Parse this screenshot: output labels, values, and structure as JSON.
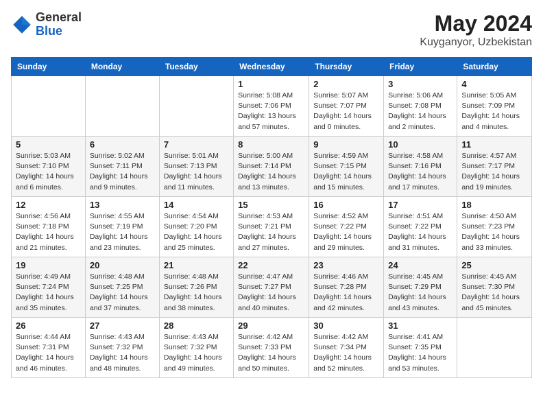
{
  "header": {
    "logo_general": "General",
    "logo_blue": "Blue",
    "month_title": "May 2024",
    "location": "Kuyganyor, Uzbekistan"
  },
  "weekdays": [
    "Sunday",
    "Monday",
    "Tuesday",
    "Wednesday",
    "Thursday",
    "Friday",
    "Saturday"
  ],
  "weeks": [
    [
      {
        "day": "",
        "info": ""
      },
      {
        "day": "",
        "info": ""
      },
      {
        "day": "",
        "info": ""
      },
      {
        "day": "1",
        "info": "Sunrise: 5:08 AM\nSunset: 7:06 PM\nDaylight: 13 hours and 57 minutes."
      },
      {
        "day": "2",
        "info": "Sunrise: 5:07 AM\nSunset: 7:07 PM\nDaylight: 14 hours and 0 minutes."
      },
      {
        "day": "3",
        "info": "Sunrise: 5:06 AM\nSunset: 7:08 PM\nDaylight: 14 hours and 2 minutes."
      },
      {
        "day": "4",
        "info": "Sunrise: 5:05 AM\nSunset: 7:09 PM\nDaylight: 14 hours and 4 minutes."
      }
    ],
    [
      {
        "day": "5",
        "info": "Sunrise: 5:03 AM\nSunset: 7:10 PM\nDaylight: 14 hours and 6 minutes."
      },
      {
        "day": "6",
        "info": "Sunrise: 5:02 AM\nSunset: 7:11 PM\nDaylight: 14 hours and 9 minutes."
      },
      {
        "day": "7",
        "info": "Sunrise: 5:01 AM\nSunset: 7:13 PM\nDaylight: 14 hours and 11 minutes."
      },
      {
        "day": "8",
        "info": "Sunrise: 5:00 AM\nSunset: 7:14 PM\nDaylight: 14 hours and 13 minutes."
      },
      {
        "day": "9",
        "info": "Sunrise: 4:59 AM\nSunset: 7:15 PM\nDaylight: 14 hours and 15 minutes."
      },
      {
        "day": "10",
        "info": "Sunrise: 4:58 AM\nSunset: 7:16 PM\nDaylight: 14 hours and 17 minutes."
      },
      {
        "day": "11",
        "info": "Sunrise: 4:57 AM\nSunset: 7:17 PM\nDaylight: 14 hours and 19 minutes."
      }
    ],
    [
      {
        "day": "12",
        "info": "Sunrise: 4:56 AM\nSunset: 7:18 PM\nDaylight: 14 hours and 21 minutes."
      },
      {
        "day": "13",
        "info": "Sunrise: 4:55 AM\nSunset: 7:19 PM\nDaylight: 14 hours and 23 minutes."
      },
      {
        "day": "14",
        "info": "Sunrise: 4:54 AM\nSunset: 7:20 PM\nDaylight: 14 hours and 25 minutes."
      },
      {
        "day": "15",
        "info": "Sunrise: 4:53 AM\nSunset: 7:21 PM\nDaylight: 14 hours and 27 minutes."
      },
      {
        "day": "16",
        "info": "Sunrise: 4:52 AM\nSunset: 7:22 PM\nDaylight: 14 hours and 29 minutes."
      },
      {
        "day": "17",
        "info": "Sunrise: 4:51 AM\nSunset: 7:22 PM\nDaylight: 14 hours and 31 minutes."
      },
      {
        "day": "18",
        "info": "Sunrise: 4:50 AM\nSunset: 7:23 PM\nDaylight: 14 hours and 33 minutes."
      }
    ],
    [
      {
        "day": "19",
        "info": "Sunrise: 4:49 AM\nSunset: 7:24 PM\nDaylight: 14 hours and 35 minutes."
      },
      {
        "day": "20",
        "info": "Sunrise: 4:48 AM\nSunset: 7:25 PM\nDaylight: 14 hours and 37 minutes."
      },
      {
        "day": "21",
        "info": "Sunrise: 4:48 AM\nSunset: 7:26 PM\nDaylight: 14 hours and 38 minutes."
      },
      {
        "day": "22",
        "info": "Sunrise: 4:47 AM\nSunset: 7:27 PM\nDaylight: 14 hours and 40 minutes."
      },
      {
        "day": "23",
        "info": "Sunrise: 4:46 AM\nSunset: 7:28 PM\nDaylight: 14 hours and 42 minutes."
      },
      {
        "day": "24",
        "info": "Sunrise: 4:45 AM\nSunset: 7:29 PM\nDaylight: 14 hours and 43 minutes."
      },
      {
        "day": "25",
        "info": "Sunrise: 4:45 AM\nSunset: 7:30 PM\nDaylight: 14 hours and 45 minutes."
      }
    ],
    [
      {
        "day": "26",
        "info": "Sunrise: 4:44 AM\nSunset: 7:31 PM\nDaylight: 14 hours and 46 minutes."
      },
      {
        "day": "27",
        "info": "Sunrise: 4:43 AM\nSunset: 7:32 PM\nDaylight: 14 hours and 48 minutes."
      },
      {
        "day": "28",
        "info": "Sunrise: 4:43 AM\nSunset: 7:32 PM\nDaylight: 14 hours and 49 minutes."
      },
      {
        "day": "29",
        "info": "Sunrise: 4:42 AM\nSunset: 7:33 PM\nDaylight: 14 hours and 50 minutes."
      },
      {
        "day": "30",
        "info": "Sunrise: 4:42 AM\nSunset: 7:34 PM\nDaylight: 14 hours and 52 minutes."
      },
      {
        "day": "31",
        "info": "Sunrise: 4:41 AM\nSunset: 7:35 PM\nDaylight: 14 hours and 53 minutes."
      },
      {
        "day": "",
        "info": ""
      }
    ]
  ]
}
